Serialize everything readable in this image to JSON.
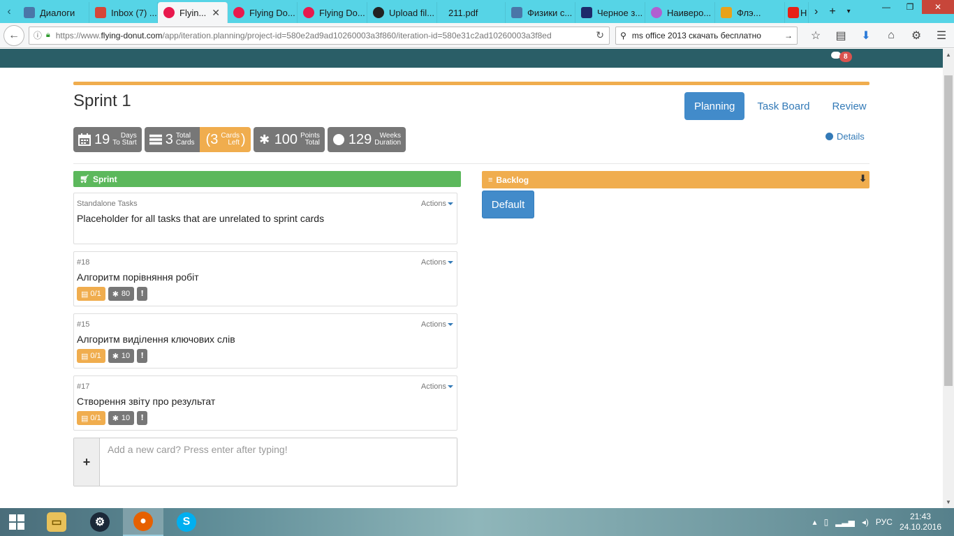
{
  "browser": {
    "tabs": [
      {
        "label": "Диалоги",
        "color": "#4a76a8"
      },
      {
        "label": "Inbox (7) ...",
        "color": "#d44638"
      },
      {
        "label": "Flyin...",
        "color": "#e8194d",
        "active": true
      },
      {
        "label": "Flying Do...",
        "color": "#e8194d"
      },
      {
        "label": "Flying Do...",
        "color": "#e8194d"
      },
      {
        "label": "Upload fil...",
        "color": "#222222"
      },
      {
        "label": "211.pdf",
        "color": "#56d4e6"
      },
      {
        "label": "Физики с...",
        "color": "#4a76a8"
      },
      {
        "label": "Черное з...",
        "color": "#1d2a6b"
      },
      {
        "label": "Наиверо...",
        "color": "#b05fd1"
      },
      {
        "label": "Флэ...",
        "color": "#e8a21a"
      },
      {
        "label": "H",
        "color": "#e62117"
      }
    ],
    "url_prefix": "https://www.",
    "url_domain": "flying-donut.com",
    "url_path": "/app/iteration.planning/project-id=580e2ad9ad10260003a3f860/iteration-id=580e31c2ad10260003a3f8ed",
    "search_value": "ms office 2013 скачать бесплатно"
  },
  "header": {
    "notification_count": "8"
  },
  "page": {
    "title": "Sprint 1",
    "view_tabs": [
      "Planning",
      "Task Board",
      "Review"
    ],
    "details_label": "Details",
    "stats": {
      "days": {
        "value": "19",
        "label1": "Days",
        "label2": "To Start"
      },
      "cards": {
        "value": "3",
        "label1": "Total",
        "label2": "Cards"
      },
      "cards_left": {
        "value": "(3",
        "label1": "Cards",
        "label2": "Left",
        "close": ")"
      },
      "points": {
        "value": "100",
        "label1": "Points",
        "label2": "Total"
      },
      "weeks": {
        "value": "129",
        "label1": "Weeks",
        "label2": "Duration"
      }
    }
  },
  "sprint_panel": {
    "title": "Sprint",
    "cards": [
      {
        "id": "Standalone Tasks",
        "title": "Placeholder for all tasks that are unrelated to sprint cards",
        "actions": "Actions"
      },
      {
        "id": "#18",
        "title": "Алгоритм порівняння робіт",
        "actions": "Actions",
        "tasks": "0/1",
        "points": "80"
      },
      {
        "id": "#15",
        "title": "Алгоритм виділення ключових слів",
        "actions": "Actions",
        "tasks": "0/1",
        "points": "10"
      },
      {
        "id": "#17",
        "title": "Створення звіту про результат",
        "actions": "Actions",
        "tasks": "0/1",
        "points": "10"
      }
    ],
    "new_card_placeholder": "Add a new card? Press enter after typing!"
  },
  "backlog_panel": {
    "title": "Backlog",
    "default_button": "Default"
  },
  "taskbar": {
    "language": "РУС",
    "time": "21:43",
    "date": "24.10.2016"
  }
}
